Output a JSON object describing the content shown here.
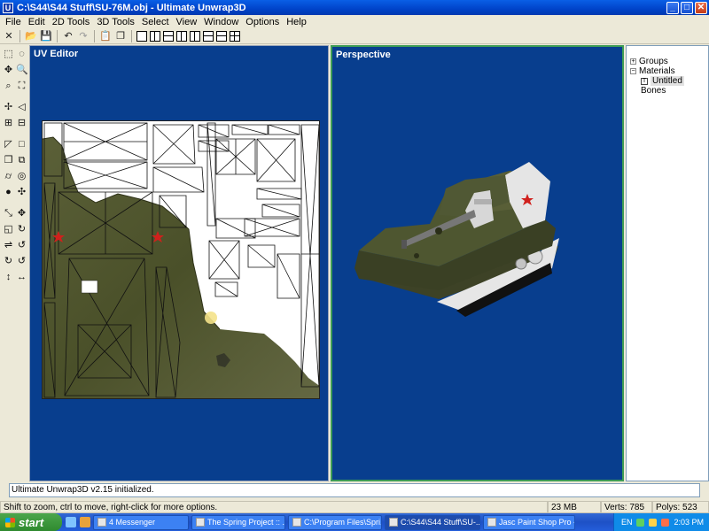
{
  "window": {
    "title": "C:\\S44\\S44 Stuff\\SU-76M.obj - Ultimate Unwrap3D",
    "icon": "U",
    "min": "_",
    "max": "□",
    "close": "✕"
  },
  "menu": [
    "File",
    "Edit",
    "2D Tools",
    "3D Tools",
    "Select",
    "View",
    "Window",
    "Options",
    "Help"
  ],
  "toolbar_icons": [
    "close-file-icon",
    "open-folder-icon",
    "save-icon",
    "undo-icon",
    "redo-icon",
    "paste-icon",
    "copy-icon"
  ],
  "panels": {
    "uv_editor_title": "UV Editor",
    "perspective_title": "Perspective"
  },
  "tree": {
    "groups": "Groups",
    "materials": "Materials",
    "material_item": "Untitled",
    "bones": "Bones",
    "expander": "+",
    "collapser": "−",
    "texture_icon": "T"
  },
  "log": "Ultimate Unwrap3D  v2.15 initialized.",
  "status": {
    "hint": "Shift to zoom, ctrl to move, right-click for more options.",
    "memory": "23 MB",
    "verts": "Verts: 785",
    "polys": "Polys: 523"
  },
  "taskbar": {
    "start": "start",
    "tasks": [
      {
        "label": "4 Messenger"
      },
      {
        "label": "The Spring Project :: ..."
      },
      {
        "label": "C:\\Program Files\\Spri..."
      },
      {
        "label": "C:\\S44\\S44 Stuff\\SU-..."
      },
      {
        "label": "Jasc Paint Shop Pro - ..."
      }
    ],
    "language": "EN",
    "clock": "2:03 PM"
  },
  "colors": {
    "viewport_bg": "#083e8e",
    "active_border": "#3e9d55",
    "tank_olive": "#4b5228",
    "star_red": "#d0201c"
  }
}
